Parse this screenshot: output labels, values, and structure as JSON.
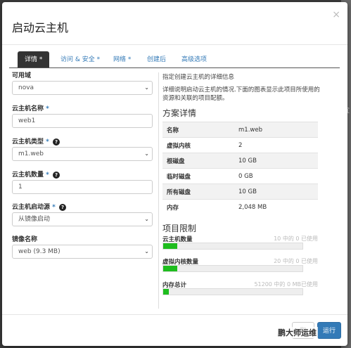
{
  "background": {
    "side_text": "宜"
  },
  "dialog": {
    "title": "启动云主机",
    "close": "×"
  },
  "tabs": [
    {
      "label": "详情",
      "required": "*",
      "active": true
    },
    {
      "label": "访问 & 安全",
      "required": "*",
      "active": false
    },
    {
      "label": "网络",
      "required": "*",
      "active": false
    },
    {
      "label": "创建后",
      "required": "",
      "active": false
    },
    {
      "label": "高级选项",
      "required": "",
      "active": false
    }
  ],
  "form": {
    "availability_zone": {
      "label": "可用域",
      "value": "nova"
    },
    "instance_name": {
      "label": "云主机名称",
      "required": "*",
      "value": "web1"
    },
    "flavor": {
      "label": "云主机类型",
      "required": "*",
      "help": "?",
      "value": "m1.web"
    },
    "instance_count": {
      "label": "云主机数量",
      "required": "*",
      "help": "?",
      "value": "1"
    },
    "boot_source": {
      "label": "云主机启动源",
      "required": "*",
      "help": "?",
      "value": "从镜像启动"
    },
    "image_name": {
      "label": "镜像名称",
      "value": "web (9.3 MB)"
    }
  },
  "info": {
    "heading": "指定创建云主机的详细信息",
    "description": "详细说明启动云主机的情况.下面的图表显示此项目所使用的资源和关联的项目配额。"
  },
  "flavor_details": {
    "title": "方案详情",
    "rows": [
      {
        "key": "名称",
        "value": "m1.web"
      },
      {
        "key": "虚拟内核",
        "value": "2"
      },
      {
        "key": "根磁盘",
        "value": "10 GB"
      },
      {
        "key": "临时磁盘",
        "value": "0 GB"
      },
      {
        "key": "所有磁盘",
        "value": "10 GB"
      },
      {
        "key": "内存",
        "value": "2,048 MB"
      }
    ]
  },
  "project_limits": {
    "title": "项目限制",
    "items": [
      {
        "label": "云主机数量",
        "note": "10 中的 0 已使用",
        "fraction": 0.1
      },
      {
        "label": "虚拟内核数量",
        "note": "20 中的 0 已使用",
        "fraction": 0.1
      },
      {
        "label": "内存总计",
        "note": "51200 中的 0 MB已使用",
        "fraction": 0.04
      }
    ]
  },
  "footer": {
    "cancel_label": "取",
    "launch_label": "运行"
  },
  "watermark": "鹏大师运维",
  "colors": {
    "accent": "#337ab7",
    "progress": "#1ebd1e",
    "active_tab": "#333333"
  }
}
